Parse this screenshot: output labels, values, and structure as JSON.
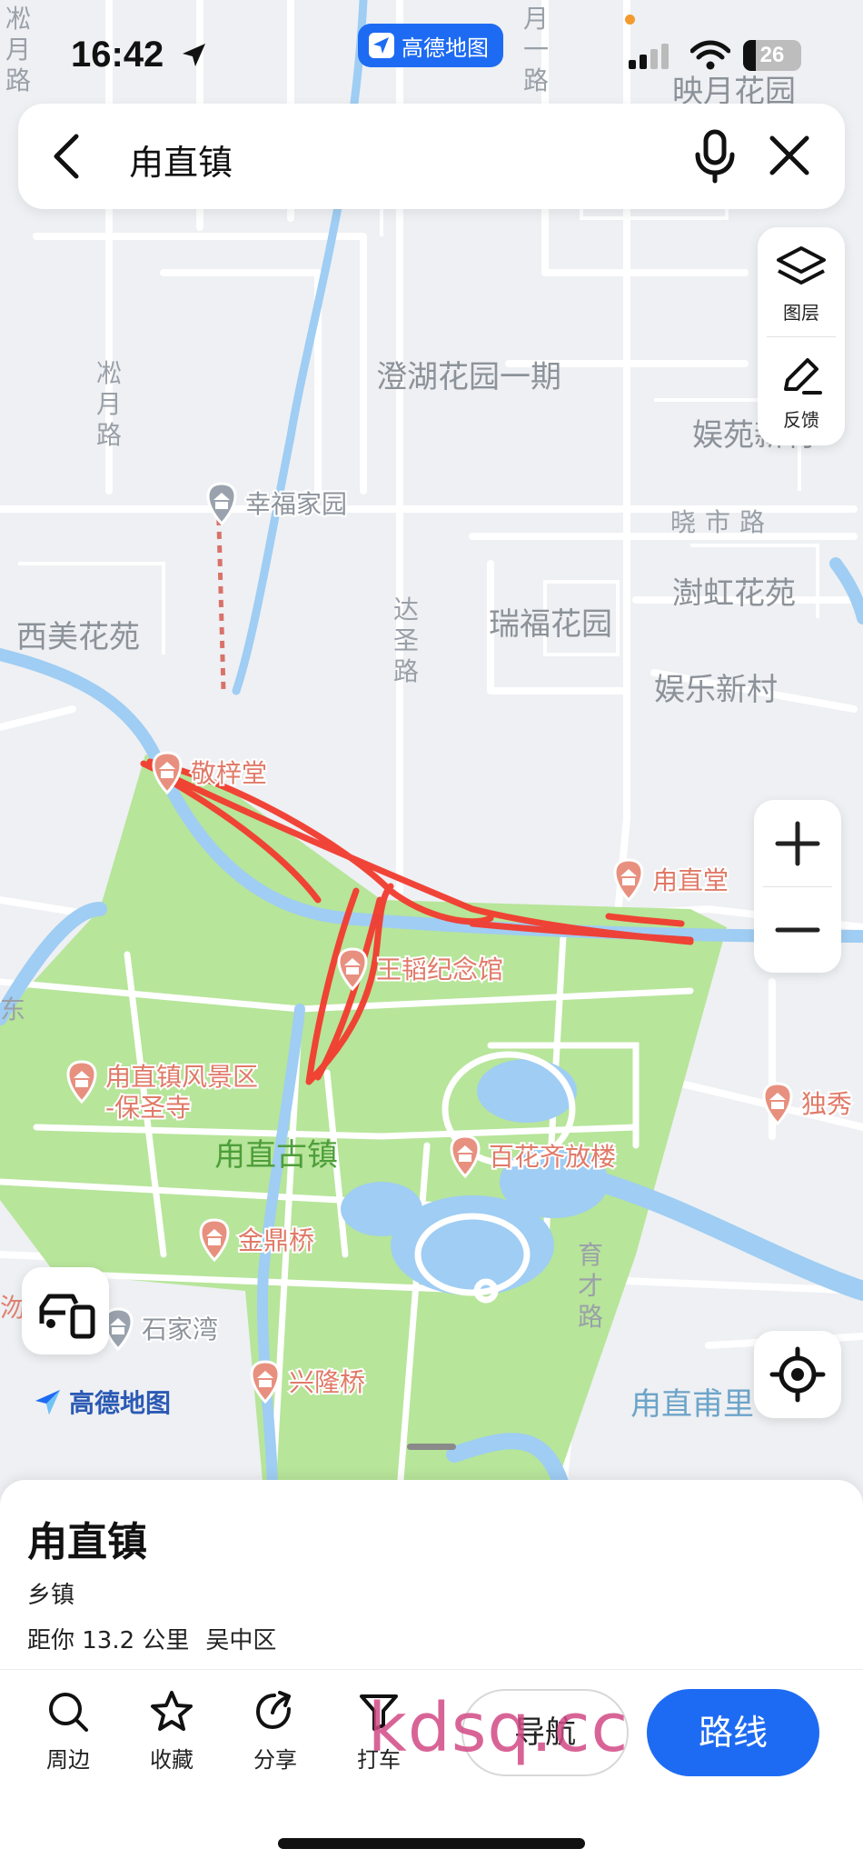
{
  "status_bar": {
    "time": "16:42",
    "app_badge": "高德地图",
    "battery": "26"
  },
  "search": {
    "query": "甪直镇"
  },
  "map": {
    "road_labels": [
      {
        "text": "凇月路",
        "vertical": true
      },
      {
        "text": "月一路",
        "vertical": true
      },
      {
        "text": "凇月路",
        "vertical": true
      },
      {
        "text": "达圣路",
        "vertical": true
      },
      {
        "text": "晓市路",
        "vertical": false
      },
      {
        "text": "育才路",
        "vertical": true
      }
    ],
    "area_labels": [
      "映月花园",
      "澄湖花园一期",
      "娱苑新村",
      "瑞福花园",
      "澍虹花苑",
      "西美花苑",
      "娱乐新村",
      "甪直古镇",
      "甪直甫里"
    ],
    "pois": [
      {
        "name": "幸福家园",
        "kind": "gray"
      },
      {
        "name": "敬梓堂",
        "kind": "red"
      },
      {
        "name": "甪直堂",
        "kind": "red"
      },
      {
        "name": "王韬纪念馆",
        "kind": "red"
      },
      {
        "name": "甪直镇风景区-保圣寺",
        "kind": "red"
      },
      {
        "name": "独秀",
        "kind": "red"
      },
      {
        "name": "百花齐放楼",
        "kind": "red"
      },
      {
        "name": "金鼎桥",
        "kind": "red"
      },
      {
        "name": "石家湾",
        "kind": "gray"
      },
      {
        "name": "兴隆桥",
        "kind": "red"
      }
    ],
    "partial_labels": [
      "沕",
      "东"
    ]
  },
  "side_tools": {
    "layers": "图层",
    "feedback": "反馈"
  },
  "brand": "高德地图",
  "place": {
    "name": "甪直镇",
    "type": "乡镇",
    "distance": "距你 13.2 公里",
    "district": "吴中区"
  },
  "actions": [
    {
      "label": "周边",
      "icon": "search-icon"
    },
    {
      "label": "收藏",
      "icon": "star-icon"
    },
    {
      "label": "分享",
      "icon": "share-icon"
    },
    {
      "label": "打车",
      "icon": "taxi-icon"
    }
  ],
  "navigate_label": "导航",
  "route_label": "路线",
  "watermark": "kdsq.cc",
  "colors": {
    "accent": "#1e6bf3",
    "park": "#b7e59a",
    "water": "#9fcdf3",
    "annotation": "#f23b2e",
    "poi": "#e8907f"
  }
}
